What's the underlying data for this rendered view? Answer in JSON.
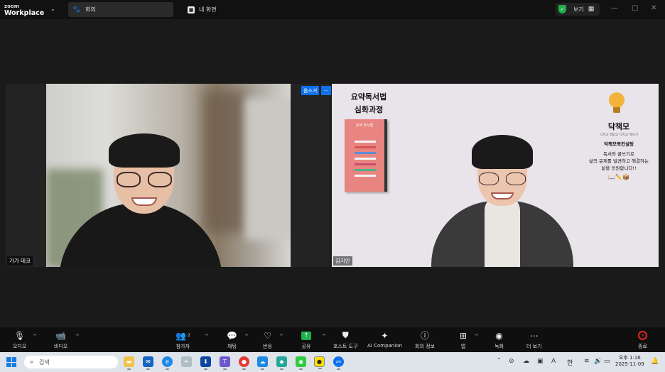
{
  "titlebar": {
    "brand_top": "zoom",
    "brand_bottom": "Workplace",
    "tabs": [
      {
        "label": "회의",
        "icon": "paw-icon"
      },
      {
        "label": "내 화면",
        "icon": "screen-icon"
      }
    ],
    "view_label": "보기"
  },
  "participants": {
    "left": {
      "name": "가가 데코"
    },
    "right": {
      "name": "김지안",
      "pin_label": "음소거"
    }
  },
  "slide": {
    "book_title_1": "요약독서법",
    "book_title_2": "심화과정",
    "book_cover_text": "요약 독서법",
    "brand_name": "닥책모",
    "brand_tagline": "닥치고 책읽고 닥치고 책쓰기",
    "brand_sub": "닥책모북컨설팅",
    "message_1": "독서와 글쓰기로",
    "message_2": "삶의 문제를 발견하고 해결하는",
    "message_3": "삶을 응원합니다!!"
  },
  "toolbar": {
    "audio": "오디오",
    "video": "비디오",
    "participants": "참가자",
    "participants_count": "2",
    "chat": "채팅",
    "reactions": "반응",
    "share": "공유",
    "host_tools": "호스트 도구",
    "ai_companion": "AI Companion",
    "meeting_info": "회의 정보",
    "apps": "앱",
    "record": "녹화",
    "more": "더 보기",
    "end": "종료"
  },
  "taskbar": {
    "search_placeholder": "검색",
    "ime": "한",
    "time": "오후 1:16",
    "date": "2025-11-09"
  }
}
